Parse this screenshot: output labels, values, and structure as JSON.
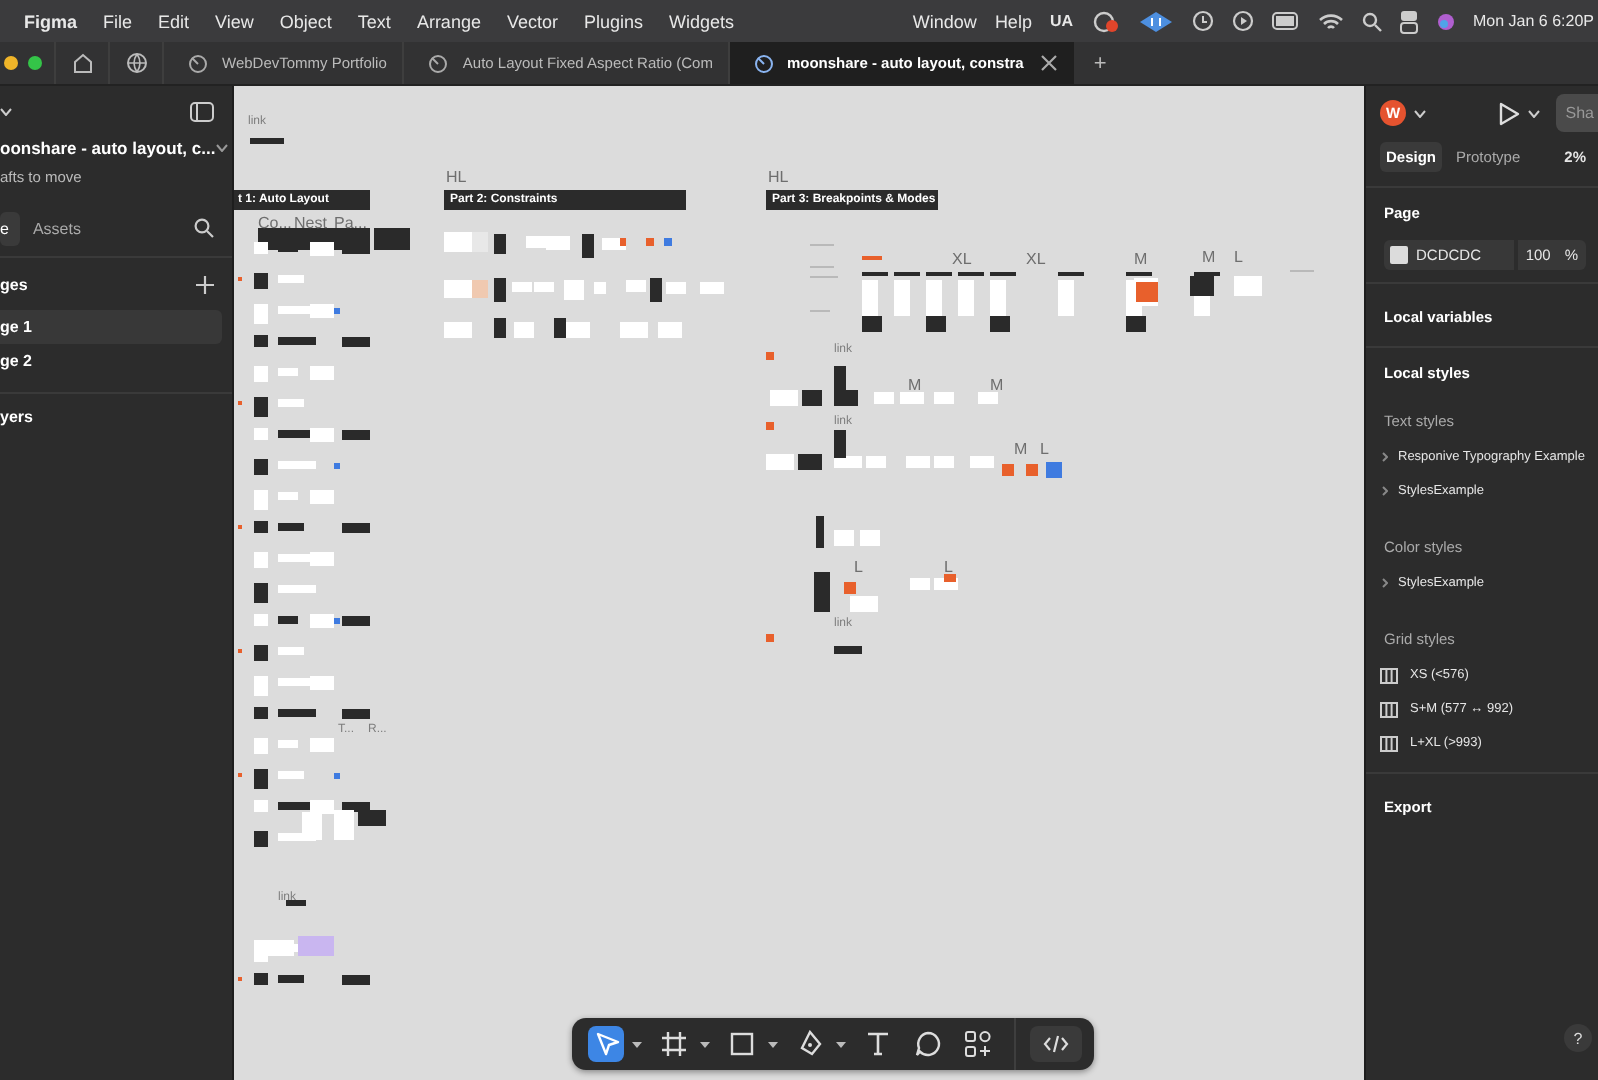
{
  "menu_bar": {
    "items": [
      "Figma",
      "File",
      "Edit",
      "View",
      "Object",
      "Text",
      "Arrange",
      "Vector",
      "Plugins",
      "Widgets"
    ],
    "right_items": [
      "Window",
      "Help"
    ],
    "status_text": "UA",
    "clock": "Mon Jan 6  6:20P"
  },
  "tabs": [
    {
      "label": "WebDevTommy Portfolio",
      "selected": false
    },
    {
      "label": "Auto Layout Fixed Aspect Ratio (Com",
      "selected": false
    },
    {
      "label": "moonshare - auto layout, constra",
      "selected": true
    }
  ],
  "new_tab": "+",
  "left_panel": {
    "file_name": "oonshare - auto layout, c...",
    "hint": "afts to move",
    "tabs": [
      {
        "label": "e",
        "selected": true
      },
      {
        "label": "Assets",
        "selected": false
      }
    ],
    "pages_title": "ges",
    "pages": [
      {
        "label": "ge 1",
        "selected": true
      },
      {
        "label": "ge 2",
        "selected": false
      }
    ],
    "layers_title": "yers"
  },
  "canvas": {
    "headings": [
      "t 1: Auto Layout",
      "Part 2: Constraints",
      "Part 3: Breakpoints & Modes"
    ],
    "labels": [
      "link",
      "HL",
      "HL",
      "Co...",
      "Nest",
      "Pa...",
      "XL",
      "XL",
      "M",
      "M",
      "L",
      "link",
      "M",
      "M",
      "link",
      "M",
      "L",
      "L",
      "L",
      "link",
      "T...",
      "R...",
      "link"
    ]
  },
  "right_panel": {
    "avatar": "W",
    "share": "Sha",
    "tabs": [
      {
        "label": "Design",
        "selected": true
      },
      {
        "label": "Prototype",
        "selected": false
      }
    ],
    "zoom": "2%",
    "page": {
      "title": "Page",
      "color": "#dcdcdc",
      "color_text": "DCDCDC",
      "opacity": "100",
      "unit": "%"
    },
    "local_variables": "Local variables",
    "local_styles": "Local styles",
    "text_styles": {
      "title": "Text styles",
      "items": [
        "Responive Typography Example",
        "StylesExample"
      ]
    },
    "color_styles": {
      "title": "Color styles",
      "items": [
        "StylesExample"
      ]
    },
    "grid_styles": {
      "title": "Grid styles",
      "items": [
        "XS (<576)",
        "S+M (577 ↔ 992)",
        "L+XL (>993)"
      ]
    },
    "export": "Export",
    "help": "?"
  },
  "toolbar": {
    "tools": [
      {
        "kind": "move",
        "selected": true,
        "dropdown": true
      },
      {
        "kind": "frame",
        "selected": false,
        "dropdown": true
      },
      {
        "kind": "shape",
        "selected": false,
        "dropdown": true
      },
      {
        "kind": "pen",
        "selected": false,
        "dropdown": true
      },
      {
        "kind": "text",
        "selected": false,
        "dropdown": false
      },
      {
        "kind": "comment",
        "selected": false,
        "dropdown": false
      },
      {
        "kind": "actions",
        "selected": false,
        "dropdown": false
      },
      {
        "kind": "devmode",
        "selected": false,
        "dropdown": false
      }
    ]
  }
}
